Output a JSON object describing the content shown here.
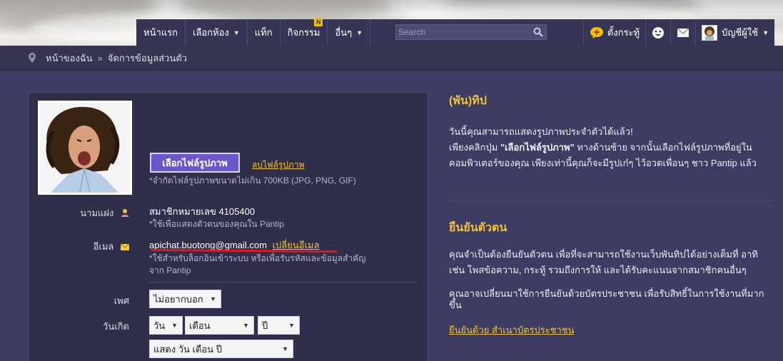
{
  "nav": {
    "items": [
      {
        "label": "หน้าแรก"
      },
      {
        "label": "เลือกห้อง",
        "caret": "▼"
      },
      {
        "label": "แท็ก"
      },
      {
        "label": "กิจกรรม",
        "badge": "N"
      },
      {
        "label": "อื่นๆ",
        "caret": "▼"
      }
    ],
    "search_placeholder": "Search",
    "feed_label": "ตั้งกระทู้",
    "account_label": "บัญชีผู้ใช้",
    "account_caret": "▼"
  },
  "breadcrumb": {
    "home": "หน้าของฉัน",
    "separator": "»",
    "current": "จัดการข้อมูลส่วนตัว"
  },
  "profile": {
    "upload_button": "เลือกไฟล์รูปภาพ",
    "delete_link": "ลบไฟล์รูปภาพ",
    "upload_note": "*จำกัดไฟล์รูปภาพขนาดไม่เกิน 700KB (JPG, PNG, GIF)",
    "alias_label": "นามแฝง",
    "alias_value": "สมาชิกหมายเลข 4105400",
    "alias_note": "*ใช้เพื่อแสดงตัวตนของคุณใน Pantip",
    "email_label": "อีเมล",
    "email_value": "apichat.buotong@gmail.com",
    "email_change_link": "เปลี่ยนอีเมล",
    "email_note_1": "*ใช้สำหรับล็อกอินเข้าระบบ หรือเพื่อรับรหัสและข้อมูลสำคัญ",
    "email_note_2": "จาก Pantip",
    "gender_label": "เพศ",
    "gender_value": "ไม่อยากบอก",
    "birthday_label": "วันเกิด",
    "day_value": "วัน",
    "month_value": "เดือน",
    "year_value": "ปี",
    "display_value": "แสดง วัน เดือน ปี"
  },
  "tips": {
    "title": "(พัน)ทิป",
    "line1": "วันนี้คุณสามารถแสดงรูปภาพประจำตัวได้แล้ว!",
    "line2_a": "เพียงคลิกปุ่ม ",
    "line2_bold": "\"เลือกไฟล์รูปภาพ\"",
    "line2_b": " ทางด้านซ้าย จากนั้นเลือกไฟล์รูปภาพที่อยู่ใน",
    "line3": "คอมพิวเตอร์ของคุณ เพียงเท่านี้คุณก็จะมีรูปเก๋ๆ ไว้อวดเพื่อนๆ ชาว Pantip แล้ว"
  },
  "verify": {
    "title": "ยืนยันตัวตน",
    "para1_line1": "คุณจำเป็นต้องยืนยันตัวตน เพื่อที่จะสามารถใช้งานเว็บพันทิปได้อย่างเต็มที่ อาทิ",
    "para1_line2": "เช่น โพสข้อความ, กระทู้ รวมถึงการให้ และได้รับคะแนนจากสมาชิกคนอื่นๆ",
    "para2_line1": "คุณอาจเปลี่ยนมาใช้การยืนยันด้วยบัตรประชาชน เพื่อรับสิทธิ์ในการใช้งานที่มาก",
    "para2_line2": "ขึ้น",
    "link": "ยืนยันด้วย สำเนาบัตรประชาชน"
  },
  "colors": {
    "background": "#3d3c62",
    "accent_yellow": "#f2c230",
    "button_purple": "#6b57c9",
    "annotation_red": "#e8141c"
  }
}
